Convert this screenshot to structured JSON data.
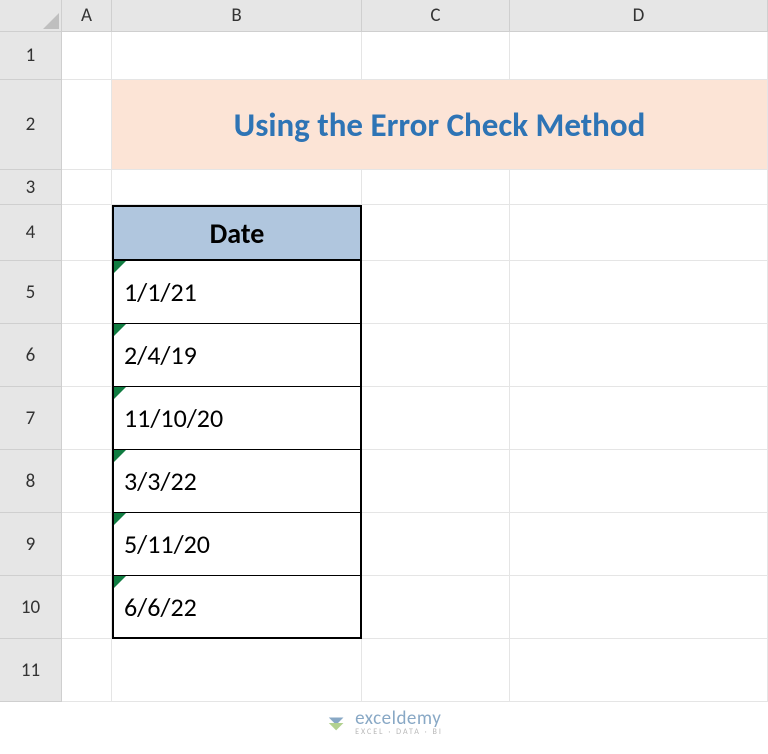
{
  "columns": [
    "A",
    "B",
    "C",
    "D"
  ],
  "rows": [
    "1",
    "2",
    "3",
    "4",
    "5",
    "6",
    "7",
    "8",
    "9",
    "10",
    "11"
  ],
  "title": "Using the Error Check Method",
  "table": {
    "header": "Date",
    "values": [
      "1/1/21",
      "2/4/19",
      "11/10/20",
      "3/3/22",
      "5/11/20",
      "6/6/22"
    ]
  },
  "watermark": {
    "brand": "exceldemy",
    "tagline": "EXCEL · DATA · BI"
  },
  "chart_data": {
    "type": "table",
    "title": "Using the Error Check Method",
    "columns": [
      "Date"
    ],
    "rows": [
      [
        "1/1/21"
      ],
      [
        "2/4/19"
      ],
      [
        "11/10/20"
      ],
      [
        "3/3/22"
      ],
      [
        "5/11/20"
      ],
      [
        "6/6/22"
      ]
    ]
  }
}
